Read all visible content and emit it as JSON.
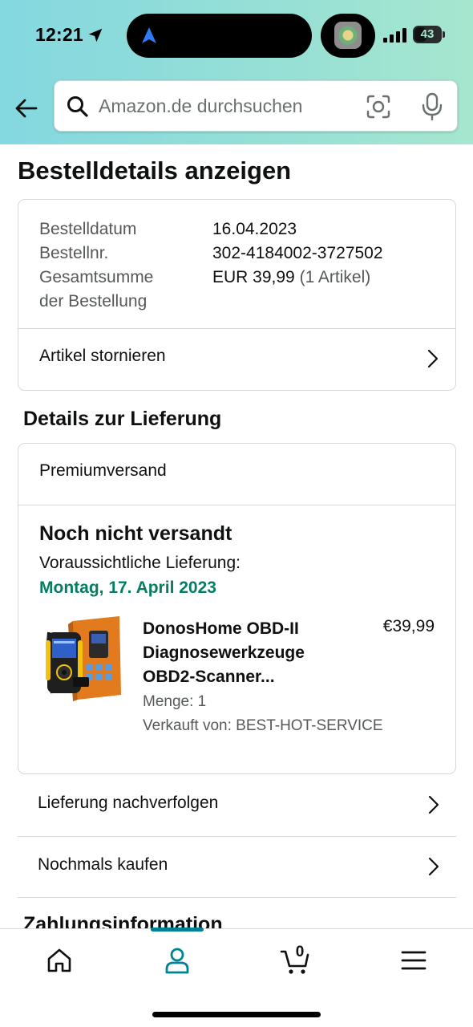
{
  "status_bar": {
    "time": "12:21",
    "battery": "43"
  },
  "search": {
    "placeholder": "Amazon.de durchsuchen"
  },
  "page_title": "Bestelldetails anzeigen",
  "order_summary": {
    "rows": [
      {
        "label": "Bestelldatum",
        "value": "16.04.2023"
      },
      {
        "label": "Bestellnr.",
        "value": "302-4184002-3727502"
      }
    ],
    "total_label_line1": "Gesamtsumme",
    "total_label_line2": "der Bestellung",
    "total_value": "EUR 39,99",
    "total_items": "(1 Artikel)",
    "cancel_label": "Artikel stornieren"
  },
  "delivery": {
    "section_title": "Details zur Lieferung",
    "shipping_method": "Premiumversand",
    "status": "Noch nicht versandt",
    "eta_label": "Voraussichtliche Lieferung:",
    "eta_date": "Montag, 17. April 2023",
    "product": {
      "title": "DonosHome OBD-II Diagnosewerkzeuge OBD2-Scanner...",
      "price": "€39,99",
      "quantity": "Menge: 1",
      "seller": "Verkauft von: BEST-HOT-SERVICE"
    }
  },
  "actions": {
    "track": "Lieferung nachverfolgen",
    "buy_again": "Nochmals kaufen"
  },
  "next_section_title": "Zahlungsinformation",
  "tabbar": {
    "cart_count": "0",
    "active_tab": "account",
    "accent_color": "#008296"
  },
  "colors": {
    "delivery_green": "#067d62",
    "header_gradient_start": "#84d8e0",
    "header_gradient_end": "#a6e6cf"
  }
}
